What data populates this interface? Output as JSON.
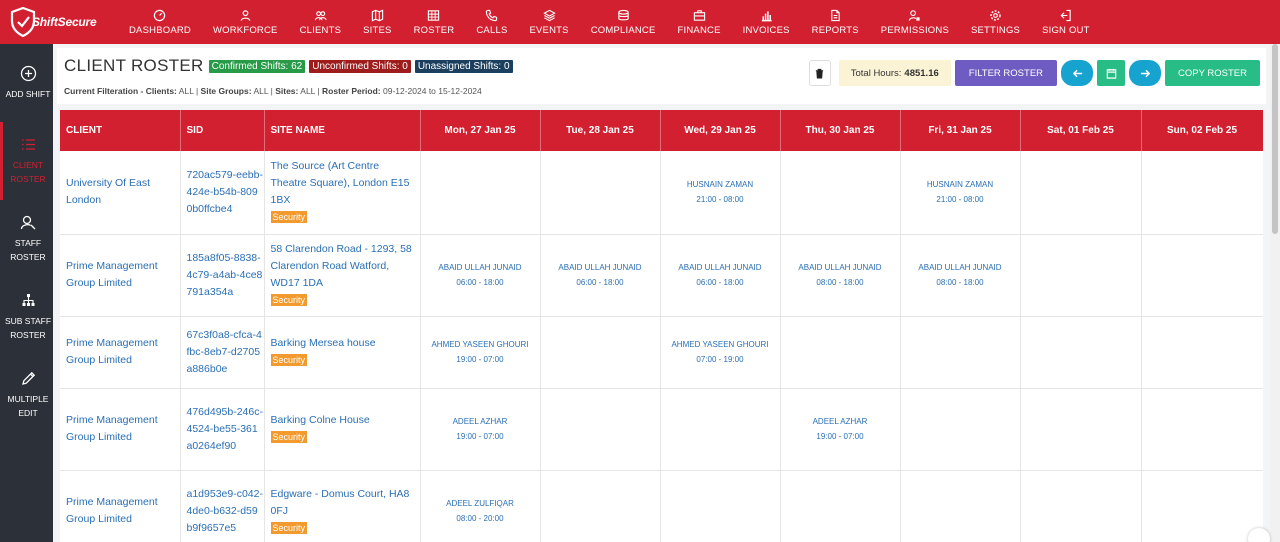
{
  "brand": {
    "name": "ShiftSecure"
  },
  "nav": [
    {
      "label": "DASHBOARD",
      "icon": "gauge-icon"
    },
    {
      "label": "WORKFORCE",
      "icon": "user-icon"
    },
    {
      "label": "CLIENTS",
      "icon": "users-icon"
    },
    {
      "label": "SITES",
      "icon": "map-icon"
    },
    {
      "label": "ROSTER",
      "icon": "table-icon"
    },
    {
      "label": "CALLS",
      "icon": "phone-icon"
    },
    {
      "label": "EVENTS",
      "icon": "layers-icon"
    },
    {
      "label": "COMPLIANCE",
      "icon": "stack-icon"
    },
    {
      "label": "FINANCE",
      "icon": "briefcase-icon"
    },
    {
      "label": "INVOICES",
      "icon": "bar-chart-icon"
    },
    {
      "label": "REPORTS",
      "icon": "document-icon"
    },
    {
      "label": "PERMISSIONS",
      "icon": "user-lock-icon"
    },
    {
      "label": "SETTINGS",
      "icon": "gear-icon"
    },
    {
      "label": "SIGN OUT",
      "icon": "sign-out-icon"
    }
  ],
  "sidebar": [
    {
      "line1": "ADD SHIFT",
      "line2": "",
      "icon": "plus-circle-icon"
    },
    {
      "line1": "CLIENT",
      "line2": "ROSTER",
      "icon": "list-icon",
      "active": true
    },
    {
      "line1": "STAFF",
      "line2": "ROSTER",
      "icon": "user-search-icon"
    },
    {
      "line1": "SUB STAFF",
      "line2": "ROSTER",
      "icon": "sitemap-icon"
    },
    {
      "line1": "MULTIPLE",
      "line2": "EDIT",
      "icon": "pencil-icon"
    }
  ],
  "header": {
    "title": "CLIENT ROSTER",
    "confirmed": "Confirmed Shifts: 62",
    "unconfirmed": "Unconfirmed Shifts: 0",
    "unassigned": "Unassigned Shifts: 0",
    "filter_label": "Current Filteration -",
    "clients_label": "Clients:",
    "clients_value": "ALL",
    "groups_label": "Site Groups:",
    "groups_value": "ALL",
    "sites_label": "Sites:",
    "sites_value": "ALL",
    "period_label": "Roster Period:",
    "period_value": "09-12-2024 to 15-12-2024"
  },
  "toolbar": {
    "hours_label": "Total Hours:",
    "hours_value": "4851.16",
    "filter_button": "FILTER ROSTER",
    "copy_button": "COPY ROSTER"
  },
  "columns": [
    "CLIENT",
    "SID",
    "SITE NAME",
    "Mon, 27 Jan 25",
    "Tue, 28 Jan 25",
    "Wed, 29 Jan 25",
    "Thu, 30 Jan 25",
    "Fri, 31 Jan 25",
    "Sat, 01 Feb 25",
    "Sun, 02 Feb 25"
  ],
  "rows": [
    {
      "client": "University Of East London",
      "sid": "720ac579-eebb-424e-b54b-8090b0ffcbe4",
      "site": "The Source (Art Centre Theatre Square), London E15 1BX",
      "tag": "Security",
      "shifts": [
        null,
        null,
        {
          "name": "HUSNAIN ZAMAN",
          "time": "21:00 - 08:00"
        },
        null,
        {
          "name": "HUSNAIN ZAMAN",
          "time": "21:00 - 08:00"
        },
        null,
        null
      ]
    },
    {
      "client": "Prime Management Group Limited",
      "sid": "185a8f05-8838-4c79-a4ab-4ce8791a354a",
      "site": "58 Clarendon Road - 1293, 58 Clarendon Road Watford, WD17 1DA",
      "tag": "Security",
      "shifts": [
        {
          "name": "ABAID ULLAH JUNAID",
          "time": "06:00 - 18:00"
        },
        {
          "name": "ABAID ULLAH JUNAID",
          "time": "06:00 - 18:00"
        },
        {
          "name": "ABAID ULLAH JUNAID",
          "time": "06:00 - 18:00"
        },
        {
          "name": "ABAID ULLAH JUNAID",
          "time": "08:00 - 18:00"
        },
        {
          "name": "ABAID ULLAH JUNAID",
          "time": "08:00 - 18:00"
        },
        null,
        null
      ]
    },
    {
      "client": "Prime Management Group Limited",
      "sid": "67c3f0a8-cfca-4fbc-8eb7-d2705a886b0e",
      "site": "Barking Mersea house",
      "tag": "Security",
      "shifts": [
        {
          "name": "AHMED YASEEN GHOURI",
          "time": "19:00 - 07:00"
        },
        null,
        {
          "name": "AHMED YASEEN GHOURI",
          "time": "07:00 - 19:00"
        },
        null,
        null,
        null,
        null
      ]
    },
    {
      "client": "Prime Management Group Limited",
      "sid": "476d495b-246c-4524-be55-361a0264ef90",
      "site": "Barking Colne House",
      "tag": "Security",
      "shifts": [
        {
          "name": "ADEEL AZHAR",
          "time": "19:00 - 07:00"
        },
        null,
        null,
        {
          "name": "ADEEL AZHAR",
          "time": "19:00 - 07:00"
        },
        null,
        null,
        null
      ]
    },
    {
      "client": "Prime Management Group Limited",
      "sid": "a1d953e9-c042-4de0-b632-d59b9f9657e5",
      "site": "Edgware - Domus Court, HA8 0FJ",
      "tag": "Security",
      "shifts": [
        {
          "name": "ADEEL ZULFIQAR",
          "time": "08:00 - 20:00"
        },
        null,
        null,
        null,
        null,
        null,
        null
      ]
    }
  ]
}
